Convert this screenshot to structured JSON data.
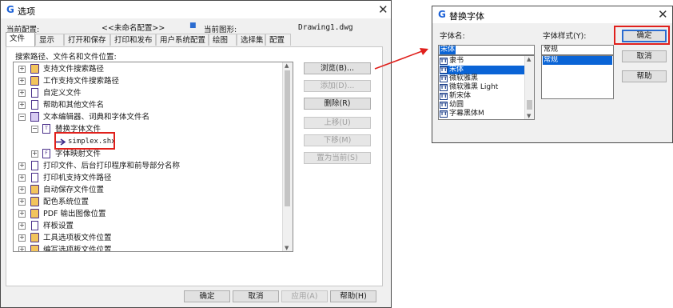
{
  "options_dialog": {
    "title": "选项",
    "current_config_label": "当前配置:",
    "current_config_value": "<<未命名配置>>",
    "current_drawing_label": "当前图形:",
    "current_drawing_value": "Drawing1.dwg",
    "tabs": [
      {
        "label": "文件",
        "active": true
      },
      {
        "label": "显示",
        "active": false
      },
      {
        "label": "打开和保存",
        "active": false
      },
      {
        "label": "打印和发布",
        "active": false
      },
      {
        "label": "用户系统配置",
        "active": false
      },
      {
        "label": "绘图",
        "active": false
      },
      {
        "label": "选择集",
        "active": false
      },
      {
        "label": "配置",
        "active": false
      }
    ],
    "search_paths_label": "搜索路径、文件名和文件位置:",
    "tree": [
      {
        "label": "支持文件搜索路径",
        "icon": "folder-stack-icon"
      },
      {
        "label": "工作支持文件搜索路径",
        "icon": "folder-stack-icon"
      },
      {
        "label": "自定义文件",
        "icon": "document-icon"
      },
      {
        "label": "帮助和其他文件名",
        "icon": "document-icon"
      },
      {
        "label": "文本编辑器、词典和字体文件名",
        "icon": "document-stack-icon"
      },
      {
        "label": "替换字体文件",
        "icon": "font-file-icon"
      },
      {
        "label": "simplex.shx",
        "icon": "arrow-right-icon"
      },
      {
        "label": "字体映射文件",
        "icon": "font-map-icon"
      },
      {
        "label": "打印文件、后台打印程序和前导部分名称",
        "icon": "document-icon"
      },
      {
        "label": "打印机支持文件路径",
        "icon": "document-icon"
      },
      {
        "label": "自动保存文件位置",
        "icon": "folder-stack-icon"
      },
      {
        "label": "配色系统位置",
        "icon": "folder-stack-icon"
      },
      {
        "label": "PDF 输出图像位置",
        "icon": "folder-stack-icon"
      },
      {
        "label": "样板设置",
        "icon": "document-icon"
      },
      {
        "label": "工具选项板文件位置",
        "icon": "folder-stack-icon"
      },
      {
        "label": "编写选项板文件位置",
        "icon": "folder-stack-icon"
      }
    ],
    "side_buttons": {
      "browse": "浏览(B)...",
      "add": "添加(D)...",
      "remove": "删除(R)",
      "move_up": "上移(U)",
      "move_down": "下移(M)",
      "set_current": "置为当前(S)"
    },
    "footer_buttons": {
      "ok": "确定",
      "cancel": "取消",
      "apply": "应用(A)",
      "help": "帮助(H)"
    }
  },
  "replace_font_dialog": {
    "title": "替换字体",
    "font_name_label": "字体名:",
    "font_style_label": "字体样式(Y):",
    "font_name_value": "宋体",
    "font_style_value": "常规",
    "font_list": [
      {
        "label": "隶书",
        "selected": false
      },
      {
        "label": "宋体",
        "selected": true
      },
      {
        "label": "微软雅黑",
        "selected": false
      },
      {
        "label": "微软雅黑 Light",
        "selected": false
      },
      {
        "label": "新宋体",
        "selected": false
      },
      {
        "label": "幼圆",
        "selected": false
      },
      {
        "label": "字幕黑体M",
        "selected": false
      }
    ],
    "style_list": [
      {
        "label": "常规",
        "selected": true
      }
    ],
    "buttons": {
      "ok": "确定",
      "cancel": "取消",
      "help": "帮助"
    }
  },
  "annotation_color": "#e0201c",
  "selection_color": "#0a64d6",
  "accent_color": "#1e63d8"
}
